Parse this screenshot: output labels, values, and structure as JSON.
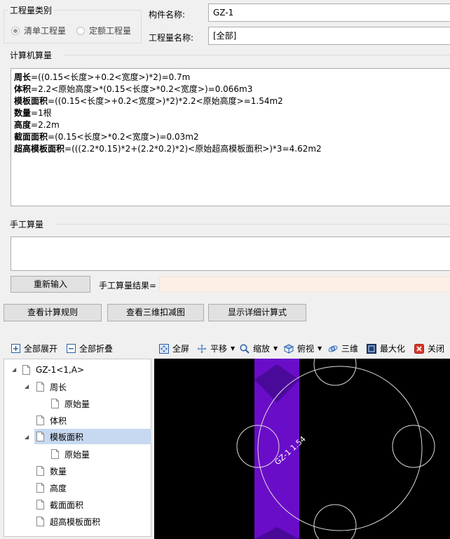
{
  "quantity_type": {
    "title": "工程量类别",
    "options": [
      {
        "label": "清单工程量",
        "selected": true
      },
      {
        "label": "定额工程量",
        "selected": false
      }
    ]
  },
  "component": {
    "name_label": "构件名称:",
    "name_value": "GZ-1",
    "qty_label": "工程量名称:",
    "qty_value": "[全部]"
  },
  "computer_calc": {
    "title": "计算机算量",
    "lines": [
      {
        "bold": "周长",
        "rest": "=((0.15<长度>+0.2<宽度>)*2)=0.7m"
      },
      {
        "bold": "体积",
        "rest": "=2.2<原始高度>*(0.15<长度>*0.2<宽度>)=0.066m3"
      },
      {
        "bold": "模板面积",
        "rest": "=((0.15<长度>+0.2<宽度>)*2)*2.2<原始高度>=1.54m2"
      },
      {
        "bold": "数量",
        "rest": "=1根"
      },
      {
        "bold": "高度",
        "rest": "=2.2m"
      },
      {
        "bold": "截面面积",
        "rest": "=(0.15<长度>*0.2<宽度>)=0.03m2"
      },
      {
        "bold": "超高模板面积",
        "rest": "=(((2.2*0.15)*2+(2.2*0.2)*2)<原始超高模板面积>)*3=4.62m2"
      }
    ]
  },
  "manual_calc": {
    "title": "手工算量",
    "reenter_label": "重新输入",
    "result_label": "手工算量结果=",
    "result_value": ""
  },
  "actions": {
    "rules_label": "查看计算规则",
    "deduct_label": "查看三维扣减图",
    "detail_label": "显示详细计算式"
  },
  "tree_toolbar": {
    "expand_all": "全部展开",
    "collapse_all": "全部折叠"
  },
  "tree": {
    "root": "GZ-1<1,A>",
    "items": [
      {
        "label": "周长"
      },
      {
        "label": "原始量"
      },
      {
        "label": "体积"
      },
      {
        "label": "模板面积"
      },
      {
        "label": "原始量"
      },
      {
        "label": "数量"
      },
      {
        "label": "高度"
      },
      {
        "label": "截面面积"
      },
      {
        "label": "超高模板面积"
      }
    ],
    "selected": "模板面积"
  },
  "view_toolbar": {
    "fullscreen": "全屏",
    "pan": "平移",
    "zoom": "缩放",
    "topview": "俯视",
    "three_d": "三维",
    "maximize": "最大化",
    "close": "关闭"
  },
  "viewport": {
    "column_label": "GZ-1 1.54",
    "column_color": "#6a0dc8",
    "column_top_color": "#4a0a99"
  }
}
